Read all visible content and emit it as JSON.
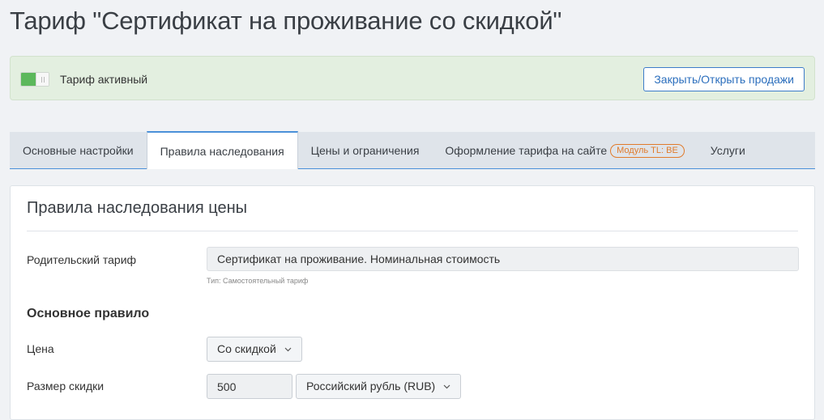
{
  "page": {
    "title": "Тариф \"Сертификат на проживание со скидкой\""
  },
  "status": {
    "toggle_on": true,
    "label": "Тариф активный",
    "sales_button": "Закрыть/Открыть продажи"
  },
  "tabs": [
    {
      "label": "Основные настройки",
      "active": false
    },
    {
      "label": "Правила наследования",
      "active": true
    },
    {
      "label": "Цены и ограничения",
      "active": false
    },
    {
      "label": "Оформление тарифа на сайте",
      "badge": "Модуль TL: BE",
      "active": false
    },
    {
      "label": "Услуги",
      "active": false
    }
  ],
  "form": {
    "section_title": "Правила наследования цены",
    "parent_label": "Родительский тариф",
    "parent_value": "Сертификат на проживание. Номинальная стоимость",
    "parent_hint": "Тип: Самостоятельный тариф",
    "main_rule_heading": "Основное правило",
    "price_label": "Цена",
    "price_select": "Со скидкой",
    "discount_label": "Размер скидки",
    "discount_value": "500",
    "currency_select": "Российский рубль (RUB)"
  },
  "colors": {
    "accent": "#4a90d9",
    "toggle_on": "#5cb85c",
    "badge": "#e07b2c",
    "status_bg": "#e3efe0"
  }
}
